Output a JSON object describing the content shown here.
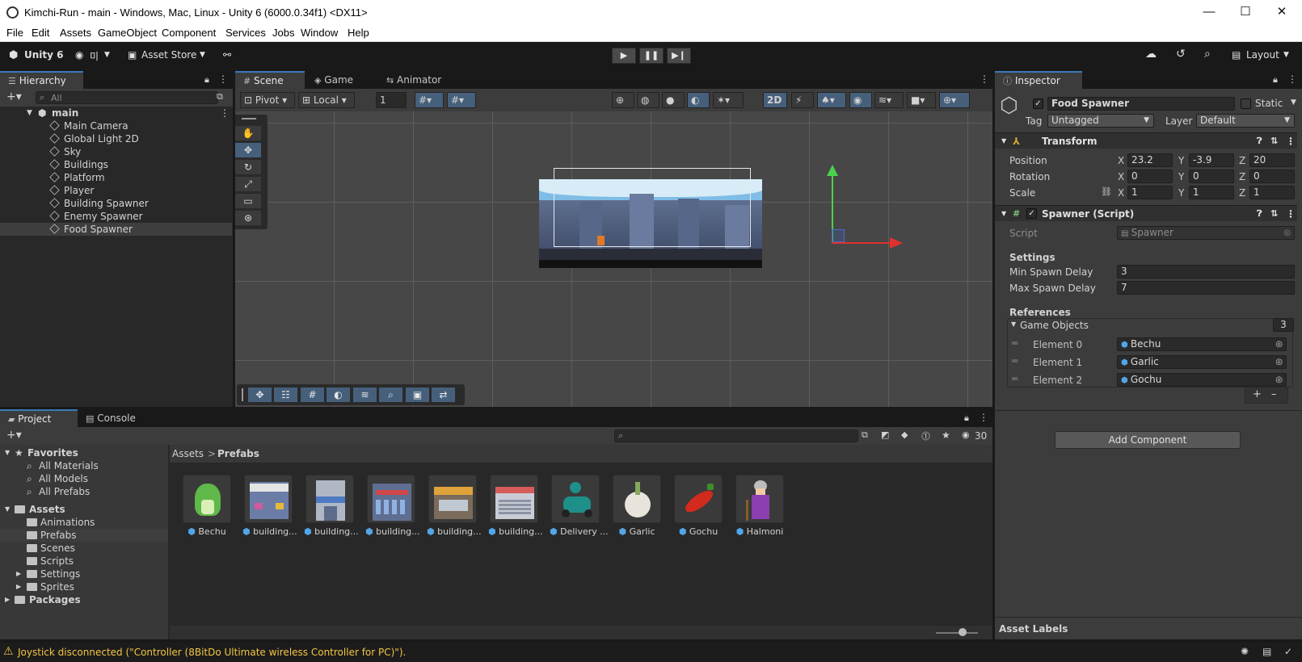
{
  "window": {
    "title": "Kimchi-Run - main - Windows, Mac, Linux - Unity 6 (6000.0.34f1) <DX11>",
    "controls": {
      "minimize": "—",
      "maximize": "☐",
      "close": "✕"
    }
  },
  "menu": [
    "File",
    "Edit",
    "Assets",
    "GameObject",
    "Component",
    "Services",
    "Jobs",
    "Window",
    "Help"
  ],
  "toolbar": {
    "brand": "Unity 6",
    "account": "미",
    "asset_store": "Asset Store",
    "layout": "Layout"
  },
  "hierarchy": {
    "tab": "Hierarchy",
    "search_placeholder": "All",
    "scene": "main",
    "items": [
      "Main Camera",
      "Global Light 2D",
      "Sky",
      "Buildings",
      "Platform",
      "Player",
      "Building Spawner",
      "Enemy Spawner",
      "Food Spawner"
    ],
    "selected": "Food Spawner"
  },
  "scene": {
    "tabs": [
      "Scene",
      "Game",
      "Animator"
    ],
    "pivot": "Pivot",
    "local": "Local",
    "grid_value": "1",
    "mode_2d": "2D"
  },
  "inspector": {
    "tab": "Inspector",
    "object_name": "Food Spawner",
    "static_label": "Static",
    "tag_label": "Tag",
    "tag_value": "Untagged",
    "layer_label": "Layer",
    "layer_value": "Default",
    "transform": {
      "title": "Transform",
      "position_label": "Position",
      "rotation_label": "Rotation",
      "scale_label": "Scale",
      "position": {
        "x": "23.2",
        "y": "-3.9",
        "z": "20"
      },
      "rotation": {
        "x": "0",
        "y": "0",
        "z": "0"
      },
      "scale": {
        "x": "1",
        "y": "1",
        "z": "1"
      }
    },
    "spawner": {
      "title": "Spawner (Script)",
      "script_label": "Script",
      "script_value": "Spawner",
      "settings_header": "Settings",
      "min_label": "Min Spawn Delay",
      "min_value": "3",
      "max_label": "Max Spawn Delay",
      "max_value": "7",
      "references_header": "References",
      "game_objects_label": "Game Objects",
      "game_objects_count": "3",
      "elements": [
        {
          "label": "Element 0",
          "value": "Bechu"
        },
        {
          "label": "Element 1",
          "value": "Garlic"
        },
        {
          "label": "Element 2",
          "value": "Gochu"
        }
      ]
    },
    "add_component": "Add Component",
    "asset_labels": "Asset Labels"
  },
  "project": {
    "tabs": [
      "Project",
      "Console"
    ],
    "favorites_label": "Favorites",
    "favorites": [
      "All Materials",
      "All Models",
      "All Prefabs"
    ],
    "assets_label": "Assets",
    "folders": [
      "Animations",
      "Prefabs",
      "Scenes",
      "Scripts",
      "Settings",
      "Sprites"
    ],
    "packages_label": "Packages",
    "breadcrumb": {
      "root": "Assets",
      "current": "Prefabs"
    },
    "hidden_count": "30",
    "assets": [
      "Bechu",
      "building...",
      "building...",
      "building...",
      "building...",
      "building...",
      "Delivery ...",
      "Garlic",
      "Gochu",
      "Halmoni"
    ]
  },
  "status": {
    "message": "Joystick disconnected (\"Controller (8BitDo Ultimate wireless Controller for PC)\").",
    "warning_color": "#f4c542"
  },
  "colors": {
    "accent": "#3a79bb",
    "selected_tool": "#46607c",
    "gizmo_x": "#e0312f",
    "gizmo_y": "#4bd14b"
  }
}
